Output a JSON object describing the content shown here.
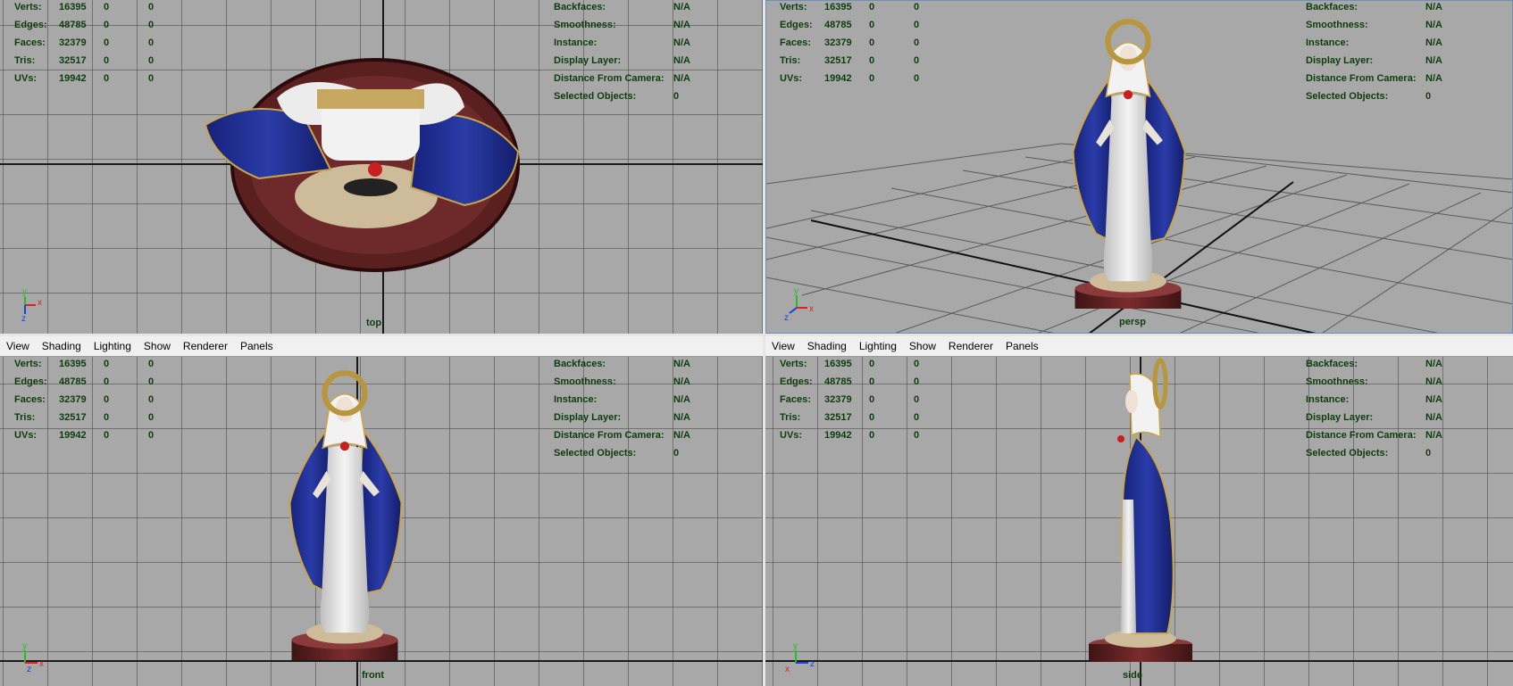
{
  "menu": [
    "View",
    "Shading",
    "Lighting",
    "Show",
    "Renderer",
    "Panels"
  ],
  "stats": [
    {
      "label": "Verts:",
      "v1": "16395",
      "v2": "0",
      "v3": "0"
    },
    {
      "label": "Edges:",
      "v1": "48785",
      "v2": "0",
      "v3": "0"
    },
    {
      "label": "Faces:",
      "v1": "32379",
      "v2": "0",
      "v3": "0"
    },
    {
      "label": "Tris:",
      "v1": "32517",
      "v2": "0",
      "v3": "0"
    },
    {
      "label": "UVs:",
      "v1": "19942",
      "v2": "0",
      "v3": "0"
    }
  ],
  "info": [
    {
      "label": "Backfaces:",
      "value": "N/A"
    },
    {
      "label": "Smoothness:",
      "value": "N/A"
    },
    {
      "label": "Instance:",
      "value": "N/A"
    },
    {
      "label": "Display Layer:",
      "value": "N/A"
    },
    {
      "label": "Distance From Camera:",
      "value": "N/A"
    },
    {
      "label": "Selected Objects:",
      "value": "0"
    }
  ],
  "cameras": {
    "top": "top",
    "persp": "persp",
    "front": "front",
    "side": "side"
  },
  "axes": {
    "x": "x",
    "y": "y",
    "z": "z"
  },
  "colors": {
    "viewport_bg": "#a8a8a8",
    "hud_text": "#0d3d0d",
    "robe_blue": "#1f2f8f",
    "gold_trim": "#c9a54a",
    "base_red": "#5a1f1f",
    "axis_x": "#e02020",
    "axis_y": "#20c020",
    "axis_z": "#2040e0"
  }
}
